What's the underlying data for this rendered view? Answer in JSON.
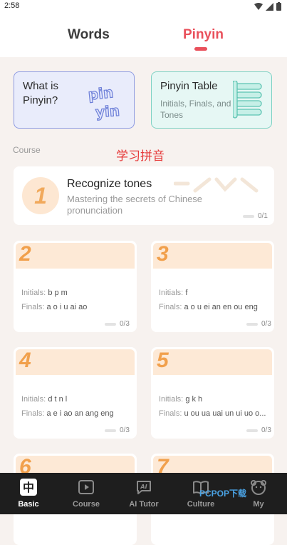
{
  "status": {
    "time": "2:58"
  },
  "tabs": {
    "words": "Words",
    "pinyin": "Pinyin"
  },
  "intro": {
    "what_is_title": "What is Pinyin?",
    "table_title": "Pinyin Table",
    "table_sub": "Initials, Finals, and Tones",
    "pinyin_art_top": "pin",
    "pinyin_art_bottom": "yin"
  },
  "section": {
    "course_label": "Course",
    "chinese_title": "学习拼音"
  },
  "lesson": {
    "num": "1",
    "title": "Recognize tones",
    "subtitle": "Mastering the secrets of Chinese pronunciation",
    "progress": "0/1"
  },
  "units": [
    {
      "num": "2",
      "initials_label": "Initials:",
      "initials": "b p m",
      "finals_label": "Finals:",
      "finals": "a o i u ai ao",
      "progress": "0/3"
    },
    {
      "num": "3",
      "initials_label": "Initials:",
      "initials": "f",
      "finals_label": "Finals:",
      "finals": "a o u ei an en ou eng",
      "progress": "0/3"
    },
    {
      "num": "4",
      "initials_label": "Initials:",
      "initials": "d t n l",
      "finals_label": "Finals:",
      "finals": "a e i ao an ang eng",
      "progress": "0/3"
    },
    {
      "num": "5",
      "initials_label": "Initials:",
      "initials": "g k h",
      "finals_label": "Finals:",
      "finals": "u ou ua uai un ui uo o...",
      "progress": "0/3"
    },
    {
      "num": "6"
    },
    {
      "num": "7"
    }
  ],
  "nav": [
    {
      "label": "Basic",
      "icon": "zhong-icon",
      "active": true
    },
    {
      "label": "Course",
      "icon": "video-icon",
      "active": false
    },
    {
      "label": "AI Tutor",
      "icon": "ai-chat-icon",
      "active": false
    },
    {
      "label": "Culture",
      "icon": "book-icon",
      "active": false
    },
    {
      "label": "My",
      "icon": "bear-icon",
      "active": false
    }
  ],
  "watermark": "PCPOP下载",
  "colors": {
    "accent": "#e9505b",
    "orange": "#f1a04c",
    "nav_bg": "#1e1e1e"
  }
}
